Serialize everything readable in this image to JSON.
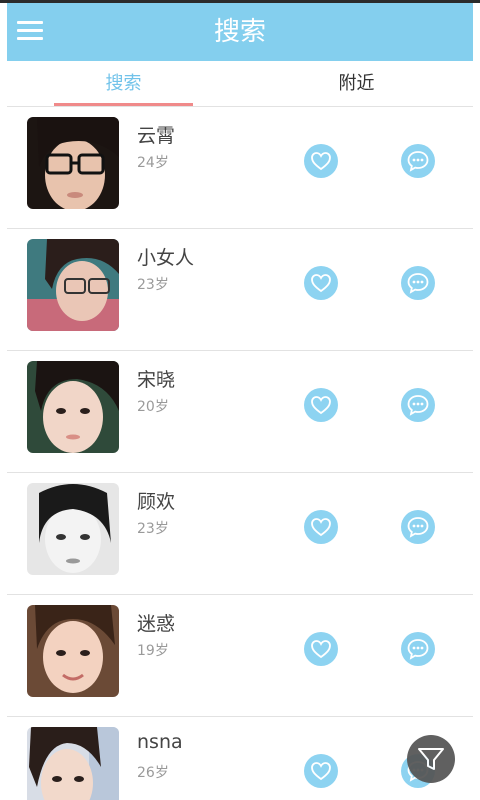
{
  "header": {
    "title": "搜索",
    "color": "#84cfee"
  },
  "tabs": [
    {
      "label": "搜索",
      "active": true
    },
    {
      "label": "附近",
      "active": false
    }
  ],
  "users": [
    {
      "name": "云霄",
      "age": "24岁"
    },
    {
      "name": "小女人",
      "age": "23岁"
    },
    {
      "name": "宋晓",
      "age": "20岁"
    },
    {
      "name": "顾欢",
      "age": "23岁"
    },
    {
      "name": "迷惑",
      "age": "19岁"
    },
    {
      "name": "nsna",
      "age": "26岁"
    }
  ],
  "icons": {
    "menu": "menu-icon",
    "like": "heart-icon",
    "message": "chat-bubble-icon",
    "filter": "filter-funnel-icon"
  },
  "colors": {
    "accent": "#84cfee",
    "action_button": "#8dd3f1",
    "active_tab_text": "#72c3ea",
    "tab_indicator": "#f08a8a",
    "fab": "#555555"
  }
}
